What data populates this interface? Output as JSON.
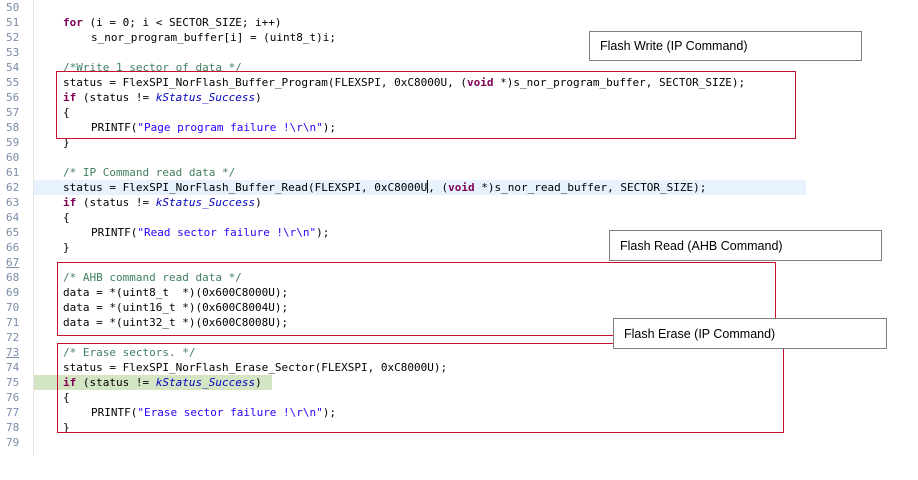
{
  "line_numbers": [
    "50",
    "51",
    "52",
    "53",
    "54",
    "55",
    "56",
    "57",
    "58",
    "59",
    "60",
    "61",
    "62",
    "63",
    "64",
    "65",
    "66",
    "67",
    "68",
    "69",
    "70",
    "71",
    "72",
    "73",
    "74",
    "75",
    "76",
    "77",
    "78",
    "79"
  ],
  "code": {
    "l51": {
      "kw": "for",
      "rest": " (i = 0; i < SECTOR_SIZE; i++)"
    },
    "l52": "s_nor_program_buffer[i] = (uint8_t)i;",
    "l54": "/*Write 1 sector of data */",
    "l55a": "status = FlexSPI_NorFlash_Buffer_Program(FLEXSPI, 0xC8000U, (",
    "l55kw": "void",
    "l55b": " *)s_nor_program_buffer, SECTOR_SIZE);",
    "l56kw": "if",
    "l56a": " (status != ",
    "l56it": "kStatus_Success",
    "l56b": ")",
    "l57": "{",
    "l58a": "PRINTF(",
    "l58str": "\"Page program failure !\\r\\n\"",
    "l58b": ");",
    "l59": "}",
    "l61": "/* IP Command read data */",
    "l62a": "status = FlexSPI_NorFlash_Buffer_Read(FLEXSPI, 0xC8000U",
    "l62b": ", (",
    "l62kw": "void",
    "l62c": " *)s_nor_read_buffer, SECTOR_SIZE);",
    "l63kw": "if",
    "l63a": " (status != ",
    "l63it": "kStatus_Success",
    "l63b": ")",
    "l64": "{",
    "l65a": "PRINTF(",
    "l65str": "\"Read sector failure !\\r\\n\"",
    "l65b": ");",
    "l66": "}",
    "l68": "/* AHB command read data */",
    "l69": "data = *(uint8_t  *)(0x600C8000U);",
    "l70": "data = *(uint16_t *)(0x600C8004U);",
    "l71": "data = *(uint32_t *)(0x600C8008U);",
    "l73": "/* Erase sectors. */",
    "l74": "status = FlexSPI_NorFlash_Erase_Sector(FLEXSPI, 0xC8000U);",
    "l75kw": "if",
    "l75a": " (status != ",
    "l75it": "kStatus_Success",
    "l75b": ")",
    "l76": "{",
    "l77a": "PRINTF(",
    "l77str": "\"Erase sector failure !\\r\\n\"",
    "l77b": ");",
    "l78": "}"
  },
  "callouts": {
    "write": "Flash Write (IP Command)",
    "read": "Flash Read (AHB Command)",
    "erase": "Flash Erase (IP Command)"
  },
  "colors": {
    "box_border": "#c8102e",
    "keyword": "#7f0055",
    "comment": "#3f7f5f",
    "string": "#2a00ff"
  }
}
